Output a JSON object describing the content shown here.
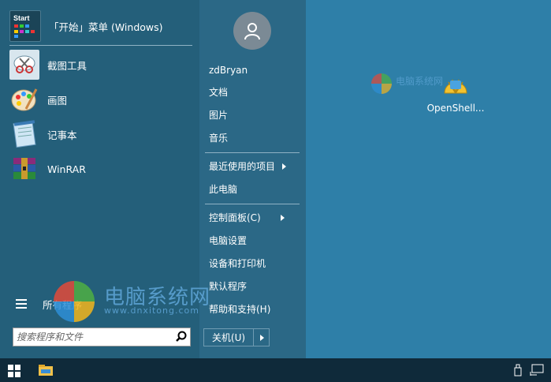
{
  "start_menu": {
    "programs": [
      {
        "label": "「开始」菜单 (Windows)",
        "icon": "start-menu-icon",
        "icon_text": "Start"
      },
      {
        "label": "截图工具",
        "icon": "snipping-tool-icon"
      },
      {
        "label": "画图",
        "icon": "paint-icon"
      },
      {
        "label": "记事本",
        "icon": "notepad-icon"
      },
      {
        "label": "WinRAR",
        "icon": "winrar-icon"
      }
    ],
    "all_programs_label": "所有程序",
    "search_placeholder": "搜索程序和文件",
    "right_items": [
      {
        "label": "zdBryan"
      },
      {
        "label": "文档"
      },
      {
        "label": "图片"
      },
      {
        "label": "音乐"
      },
      {
        "label": "最近使用的项目"
      },
      {
        "label": "此电脑"
      },
      {
        "label": "控制面板(C)"
      },
      {
        "label": "电脑设置"
      },
      {
        "label": "设备和打印机"
      },
      {
        "label": "默认程序"
      },
      {
        "label": "帮助和支持(H)"
      }
    ],
    "shutdown_label": "关机(U)"
  },
  "desktop": {
    "icons": [
      {
        "label": "OpenShell..."
      }
    ],
    "watermark": {
      "cn": "电脑系统网",
      "en": "www.dnxitong.com",
      "cn_small": "电脑系统网"
    }
  },
  "colors": {
    "desktop": "#2e7fa8",
    "menu_left": "#245f7a",
    "menu_right": "#2b6886",
    "taskbar": "#0f2a3a"
  }
}
